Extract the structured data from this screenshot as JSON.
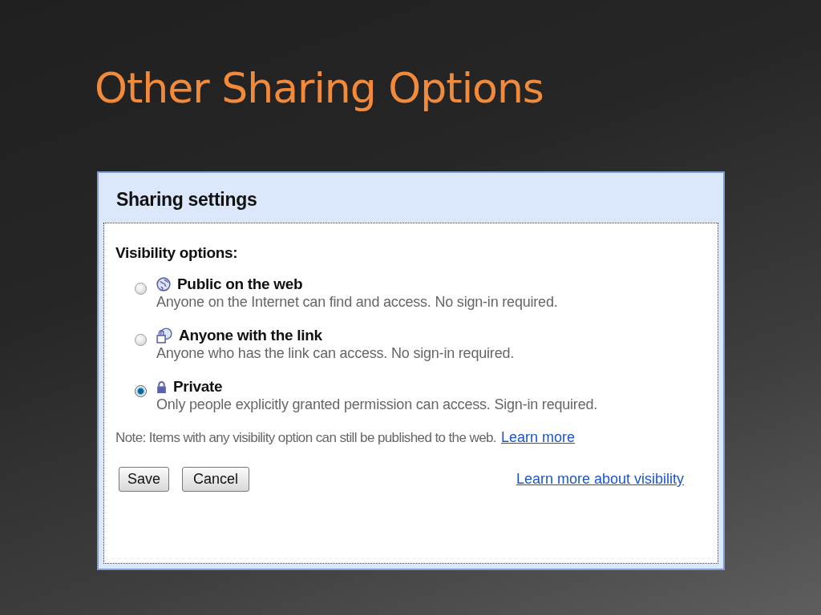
{
  "slide": {
    "title": "Other Sharing Options"
  },
  "dialog": {
    "title": "Sharing settings",
    "section_label": "Visibility options:",
    "options": [
      {
        "kind": "globe",
        "label": "Public on the web",
        "description": "Anyone on the Internet can find and access. No sign-in required.",
        "selected": false
      },
      {
        "kind": "link",
        "label": "Anyone with the link",
        "description": "Anyone who has the link can access. No sign-in required.",
        "selected": false
      },
      {
        "kind": "lock",
        "label": "Private",
        "description": "Only people explicitly granted permission can access. Sign-in required.",
        "selected": true
      }
    ],
    "note": "Note: Items with any visibility option can still be published to the web.",
    "note_link": "Learn more",
    "buttons": [
      "Save",
      "Cancel"
    ],
    "footer_link": "Learn more about visibility"
  }
}
